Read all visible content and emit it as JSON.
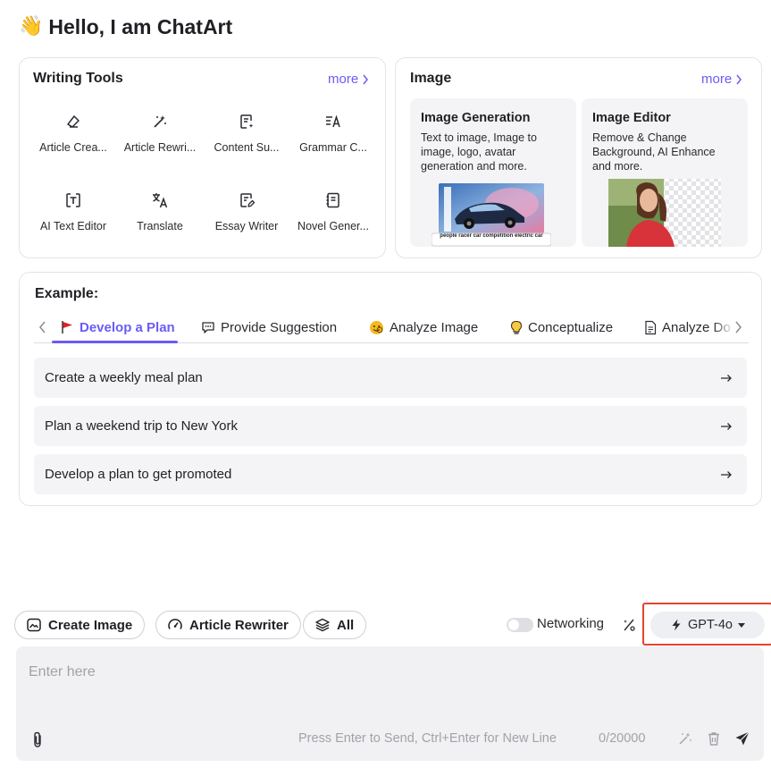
{
  "header": {
    "wave_emoji": "👋",
    "title": "Hello, I am ChatArt"
  },
  "writing_tools": {
    "title": "Writing Tools",
    "more": "more",
    "tools": [
      {
        "label": "Article Crea...",
        "icon": "eraser-pen-icon"
      },
      {
        "label": "Article Rewri...",
        "icon": "magic-wand-icon"
      },
      {
        "label": "Content Su...",
        "icon": "document-sparkle-icon"
      },
      {
        "label": "Grammar C...",
        "icon": "text-check-icon"
      },
      {
        "label": "AI Text Editor",
        "icon": "text-box-icon"
      },
      {
        "label": "Translate",
        "icon": "translate-icon"
      },
      {
        "label": "Essay Writer",
        "icon": "essay-pen-icon"
      },
      {
        "label": "Novel Gener...",
        "icon": "notebook-icon"
      }
    ]
  },
  "image": {
    "title": "Image",
    "more": "more",
    "generation": {
      "title": "Image Generation",
      "desc": "Text to image, Image to image, logo, avatar generation and more.",
      "caption": "people racer car competition electric car"
    },
    "editor": {
      "title": "Image Editor",
      "desc": "Remove & Change Background, AI Enhance and more."
    }
  },
  "example": {
    "title": "Example:",
    "tabs": [
      {
        "label": "Develop a Plan",
        "icon": "red-flag-icon"
      },
      {
        "label": "Provide Suggestion",
        "icon": "chat-bubble-icon"
      },
      {
        "label": "Analyze Image",
        "icon": "face-emoji-icon"
      },
      {
        "label": "Conceptualize",
        "icon": "lightbulb-icon"
      },
      {
        "label": "Analyze Do",
        "icon": "document-icon"
      }
    ],
    "items": [
      "Create a weekly meal plan",
      "Plan a weekend trip to New York",
      "Develop a plan to get promoted"
    ]
  },
  "toolbar": {
    "chips": [
      {
        "label": "Create Image",
        "icon": "image-icon"
      },
      {
        "label": "Article Rewriter",
        "icon": "gauge-icon"
      },
      {
        "label": "All",
        "icon": "layers-icon"
      }
    ],
    "networking_label": "Networking",
    "networking_on": false,
    "model": "GPT-4o"
  },
  "composer": {
    "placeholder": "Enter here",
    "hint": "Press Enter to Send, Ctrl+Enter for New Line",
    "counter": "0/20000"
  },
  "colors": {
    "accent": "#6b5cf6",
    "highlight_box": "#e5442f",
    "panel_bg": "#f4f4f6"
  }
}
